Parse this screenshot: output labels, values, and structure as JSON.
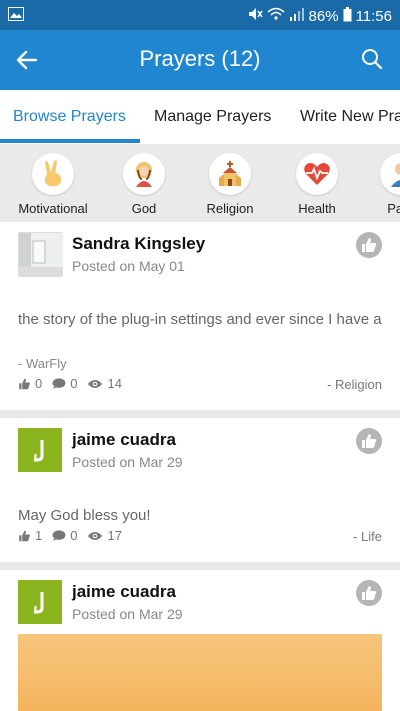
{
  "status_bar": {
    "battery": "86%",
    "time": "11:56"
  },
  "app_bar": {
    "title": "Prayers (12)"
  },
  "tabs": [
    {
      "label": "Browse Prayers"
    },
    {
      "label": "Manage Prayers"
    },
    {
      "label": "Write New Pra"
    }
  ],
  "categories": [
    {
      "label": "Motivational",
      "icon": "victory-hand-icon"
    },
    {
      "label": "God",
      "icon": "jesus-icon"
    },
    {
      "label": "Religion",
      "icon": "church-icon"
    },
    {
      "label": "Health",
      "icon": "heart-pulse-icon"
    },
    {
      "label": "Pare",
      "icon": "parent-icon"
    }
  ],
  "posts": [
    {
      "author": "Sandra Kingsley",
      "posted": "Posted on May 01",
      "text": "the story of the plug-in settings and ever since I have a",
      "signoff": "- WarFly",
      "likes": "0",
      "comments": "0",
      "views": "14",
      "category": "- Religion"
    },
    {
      "author": "jaime cuadra",
      "posted": "Posted on Mar 29",
      "text": "May God bless you!",
      "likes": "1",
      "comments": "0",
      "views": "17",
      "category": "- Life"
    },
    {
      "author": "jaime cuadra",
      "posted": "Posted on Mar 29"
    }
  ],
  "colors": {
    "primary": "#1f86cf",
    "status_bar": "#1a6aa8",
    "avatar_green": "#8ab51e"
  }
}
